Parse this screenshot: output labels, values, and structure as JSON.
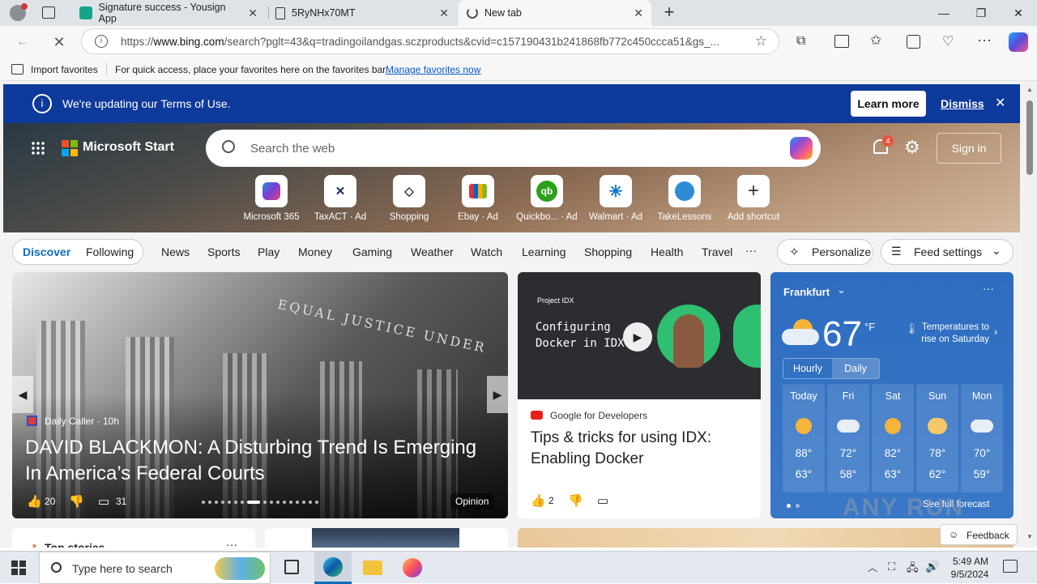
{
  "tabs": [
    {
      "title": "Signature success - Yousign App"
    },
    {
      "title": "5RyNHx70MT"
    },
    {
      "title": "New tab"
    }
  ],
  "address": {
    "url_prefix": "https://",
    "url_host": "www.bing.com",
    "url_rest": "/search?pglt=43&q=tradingoilandgas.sczproducts&cvid=c157190431b241868fb772c450ccca51&gs_..."
  },
  "favorites": {
    "import_label": "Import favorites",
    "hint": "For quick access, place your favorites here on the favorites bar.",
    "manage_link": "Manage favorites now"
  },
  "banner": {
    "text": "We're updating our Terms of Use.",
    "learn_more": "Learn more",
    "dismiss": "Dismiss"
  },
  "header": {
    "brand": "Microsoft Start",
    "search_placeholder": "Search the web",
    "notif_count": "4",
    "sign_in": "Sign in"
  },
  "shortcuts": [
    {
      "label": "Microsoft 365",
      "ad": ""
    },
    {
      "label": "TaxACT",
      "ad": "· Ad"
    },
    {
      "label": "Shopping",
      "ad": ""
    },
    {
      "label": "Ebay",
      "ad": "· Ad"
    },
    {
      "label": "Quickbo...",
      "ad": "· Ad"
    },
    {
      "label": "Walmart",
      "ad": "· Ad"
    },
    {
      "label": "TakeLessons",
      "ad": ""
    },
    {
      "label": "Add shortcut",
      "ad": ""
    }
  ],
  "nav": {
    "discover": "Discover",
    "following": "Following",
    "items": [
      "News",
      "Sports",
      "Play",
      "Money",
      "Gaming",
      "Weather",
      "Watch",
      "Learning",
      "Shopping",
      "Health",
      "Travel"
    ],
    "more": "···",
    "personalize": "Personalize",
    "feed_settings": "Feed settings"
  },
  "main_story": {
    "source": "Daily Caller · 10h",
    "headline": "DAVID BLACKMON: A Disturbing Trend Is Emerging In America’s Federal Courts",
    "likes": "20",
    "comments": "31",
    "tag": "Opinion",
    "image_text": "EQUAL JUSTICE UNDER"
  },
  "video_story": {
    "brand": "Project IDX",
    "thumb_text_1": "Configuring",
    "thumb_text_2": "Docker in IDX",
    "source": "Google for Developers",
    "headline": "Tips & tricks for using IDX: Enabling Docker",
    "likes": "2"
  },
  "weather": {
    "city": "Frankfurt",
    "temp": "67",
    "unit": "°F",
    "note": "Temperatures to rise on Saturday",
    "tab_hourly": "Hourly",
    "tab_daily": "Daily",
    "days": [
      {
        "day": "Today",
        "hi": "88°",
        "lo": "63°"
      },
      {
        "day": "Fri",
        "hi": "72°",
        "lo": "58°"
      },
      {
        "day": "Sat",
        "hi": "82°",
        "lo": "63°"
      },
      {
        "day": "Sun",
        "hi": "78°",
        "lo": "62°"
      },
      {
        "day": "Mon",
        "hi": "70°",
        "lo": "59°"
      }
    ],
    "full_forecast": "See full forecast"
  },
  "bottom": {
    "top_stories": "Top stories",
    "feedback": "Feedback"
  },
  "watermark": "ANY RUN",
  "taskbar": {
    "search_placeholder": "Type here to search",
    "time": "5:49 AM",
    "date": "9/5/2024"
  },
  "colors": {
    "banner": "#0d3a9b",
    "weather_bg": "#2f6fbe",
    "accent": "#0f6cbd"
  }
}
